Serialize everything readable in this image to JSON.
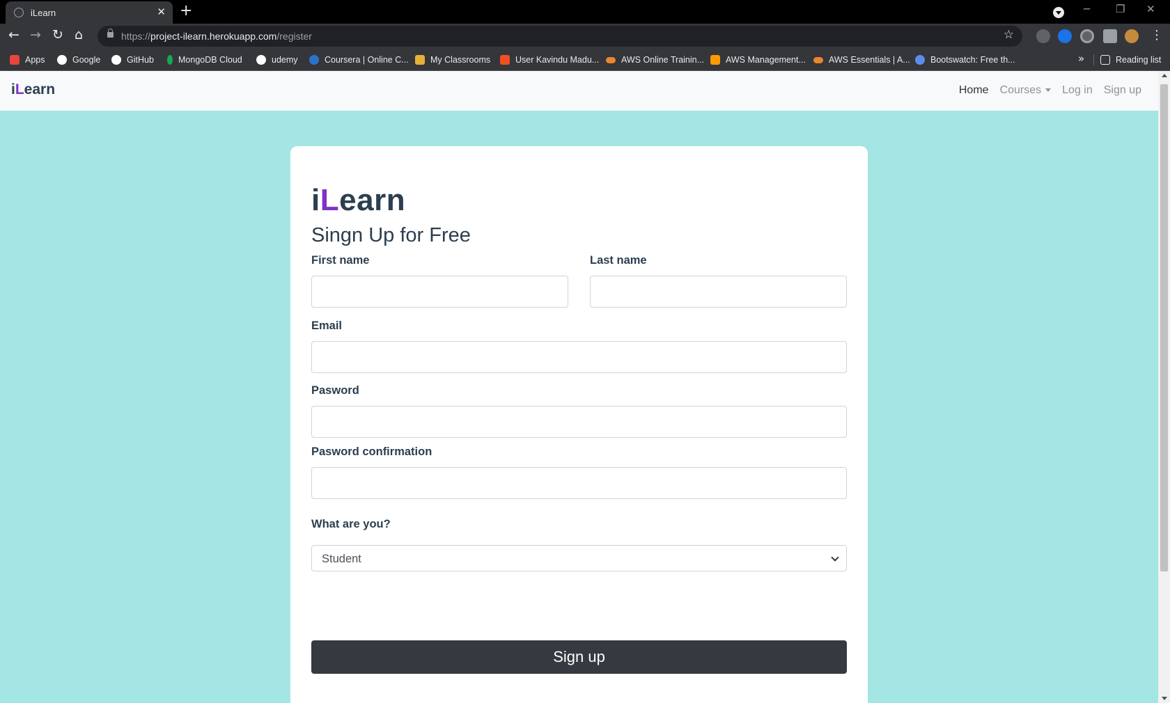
{
  "browser": {
    "tab": {
      "title": "iLearn"
    },
    "address": {
      "scheme": "https://",
      "host": "project-ilearn.herokuapp.com",
      "path": "/register"
    },
    "bookmarks": [
      {
        "label": "Apps",
        "icon": "apps-grid-icon",
        "color": "#e8453c"
      },
      {
        "label": "Google",
        "icon": "google-icon",
        "color": "#ffffff"
      },
      {
        "label": "GitHub",
        "icon": "github-icon",
        "color": "#ffffff"
      },
      {
        "label": "MongoDB Cloud",
        "icon": "mongodb-leaf-icon",
        "color": "#13aa52"
      },
      {
        "label": "udemy",
        "icon": "udemy-icon",
        "color": "#ffffff"
      },
      {
        "label": "Coursera | Online C...",
        "icon": "coursera-icon",
        "color": "#2a73cc"
      },
      {
        "label": "My Classrooms",
        "icon": "box-icon",
        "color": "#e5b13a"
      },
      {
        "label": "User Kavindu Madu...",
        "icon": "grid-icon",
        "color": "#f25022"
      },
      {
        "label": "AWS Online Trainin...",
        "icon": "aws-cloud-icon",
        "color": "#e9862f"
      },
      {
        "label": "AWS Management...",
        "icon": "aws-cube-icon",
        "color": "#ff9900"
      },
      {
        "label": "AWS Essentials | A...",
        "icon": "aws-cloud-icon",
        "color": "#e9862f"
      },
      {
        "label": "Bootswatch: Free th...",
        "icon": "bootswatch-icon",
        "color": "#5b8def"
      }
    ],
    "reading_list": "Reading list"
  },
  "navbar": {
    "brand_prefix": "i",
    "brand_accent": "L",
    "brand_rest": "earn",
    "links": {
      "home": "Home",
      "courses": "Courses",
      "login": "Log in",
      "signup": "Sign up"
    }
  },
  "form": {
    "logo_prefix": "i",
    "logo_accent": "L",
    "logo_rest": "earn",
    "subtitle": "Singn Up for Free",
    "first_name_label": "First name",
    "last_name_label": "Last name",
    "email_label": "Email",
    "password_label": "Pasword",
    "password_confirm_label": "Pasword confirmation",
    "role_label": "What are you?",
    "role_value": "Student",
    "submit_label": "Sign up"
  },
  "colors": {
    "page_background": "#a3e6e4",
    "brand_accent": "#7e31c9",
    "submit_button": "#343a40",
    "heading_text": "#2c3e50"
  }
}
